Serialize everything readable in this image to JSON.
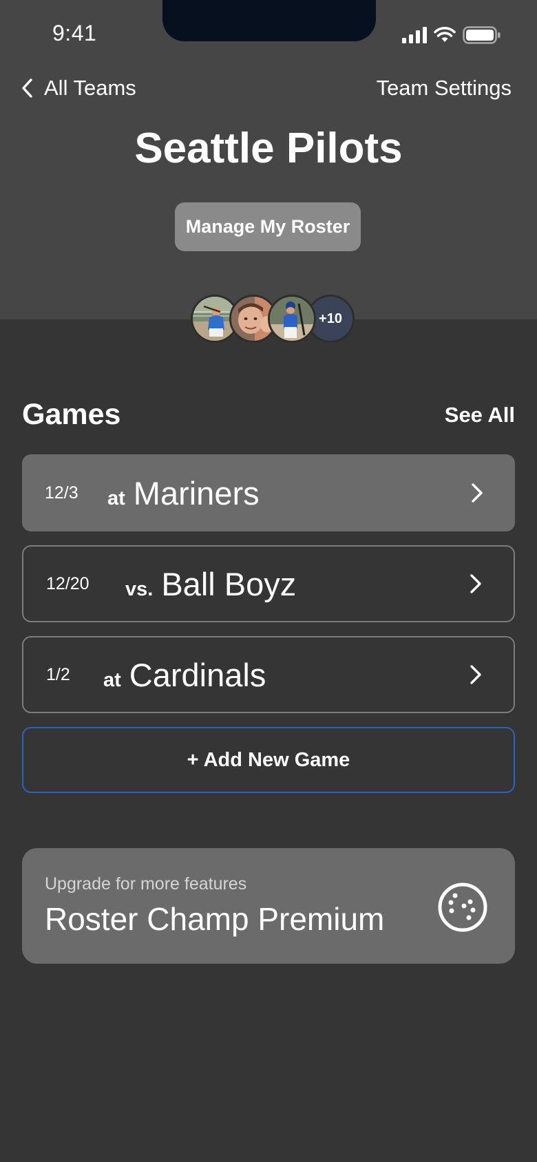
{
  "status_bar": {
    "time": "9:41",
    "icons": [
      "cellular-signal-icon",
      "wifi-icon",
      "battery-icon"
    ]
  },
  "nav": {
    "back_label": "All Teams",
    "back_icon": "chevron-left-icon",
    "settings_label": "Team Settings"
  },
  "team": {
    "name": "Seattle Pilots",
    "manage_roster_label": "Manage My Roster",
    "roster_more_count": "+10",
    "roster_avatar_count": 3
  },
  "games": {
    "section_title": "Games",
    "see_all_label": "See All",
    "items": [
      {
        "date": "12/3",
        "prefix": "at",
        "opponent": "Mariners",
        "highlighted": true
      },
      {
        "date": "12/20",
        "prefix": "vs.",
        "opponent": "Ball Boyz",
        "highlighted": false
      },
      {
        "date": "1/2",
        "prefix": "at",
        "opponent": "Cardinals",
        "highlighted": false
      }
    ],
    "add_new_label": "+ Add New Game"
  },
  "premium": {
    "subtitle": "Upgrade for more features",
    "title": "Roster Champ Premium",
    "icon": "baseball-icon"
  },
  "colors": {
    "background": "#353535",
    "header_background": "#464646",
    "card_filled": "#6b6b6b",
    "card_outline": "#7c7c7c",
    "accent_blue": "#2f5fbf",
    "manage_button": "#8a8a8a",
    "avatar_more": "#3b4359"
  }
}
